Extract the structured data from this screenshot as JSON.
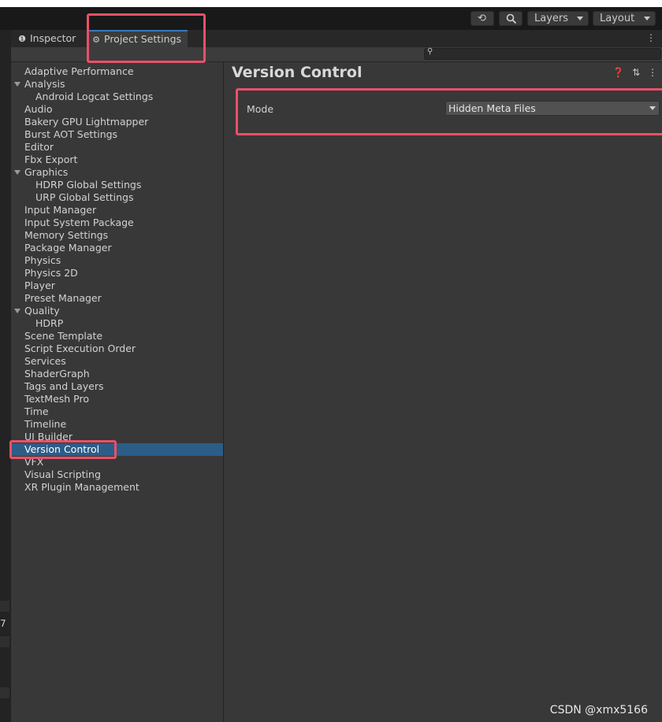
{
  "toolbar": {
    "layers_label": "Layers",
    "layout_label": "Layout"
  },
  "tabs": [
    {
      "label": "Inspector",
      "icon": "info-icon"
    },
    {
      "label": "Project Settings",
      "icon": "gear-icon"
    }
  ],
  "sidebar": {
    "items": [
      {
        "label": "Adaptive Performance",
        "level": 0
      },
      {
        "label": "Analysis",
        "level": 0,
        "expanded": true
      },
      {
        "label": "Android Logcat Settings",
        "level": 1
      },
      {
        "label": "Audio",
        "level": 0
      },
      {
        "label": "Bakery GPU Lightmapper",
        "level": 0
      },
      {
        "label": "Burst AOT Settings",
        "level": 0
      },
      {
        "label": "Editor",
        "level": 0
      },
      {
        "label": "Fbx Export",
        "level": 0
      },
      {
        "label": "Graphics",
        "level": 0,
        "expanded": true
      },
      {
        "label": "HDRP Global Settings",
        "level": 1
      },
      {
        "label": "URP Global Settings",
        "level": 1
      },
      {
        "label": "Input Manager",
        "level": 0
      },
      {
        "label": "Input System Package",
        "level": 0
      },
      {
        "label": "Memory Settings",
        "level": 0
      },
      {
        "label": "Package Manager",
        "level": 0
      },
      {
        "label": "Physics",
        "level": 0
      },
      {
        "label": "Physics 2D",
        "level": 0
      },
      {
        "label": "Player",
        "level": 0
      },
      {
        "label": "Preset Manager",
        "level": 0
      },
      {
        "label": "Quality",
        "level": 0,
        "expanded": true
      },
      {
        "label": "HDRP",
        "level": 1
      },
      {
        "label": "Scene Template",
        "level": 0
      },
      {
        "label": "Script Execution Order",
        "level": 0
      },
      {
        "label": "Services",
        "level": 0
      },
      {
        "label": "ShaderGraph",
        "level": 0
      },
      {
        "label": "Tags and Layers",
        "level": 0
      },
      {
        "label": "TextMesh Pro",
        "level": 0
      },
      {
        "label": "Time",
        "level": 0
      },
      {
        "label": "Timeline",
        "level": 0
      },
      {
        "label": "UI Builder",
        "level": 0
      },
      {
        "label": "Version Control",
        "level": 0,
        "selected": true
      },
      {
        "label": "VFX",
        "level": 0
      },
      {
        "label": "Visual Scripting",
        "level": 0
      },
      {
        "label": "XR Plugin Management",
        "level": 0
      }
    ]
  },
  "content": {
    "title": "Version Control",
    "mode_label": "Mode",
    "mode_value": "Hidden Meta Files"
  },
  "left_panel_number": "7",
  "watermark": "CSDN @xmx5166",
  "colors": {
    "highlight": "#e9506a",
    "selection": "#2c5d87",
    "accent": "#3a79bb"
  }
}
